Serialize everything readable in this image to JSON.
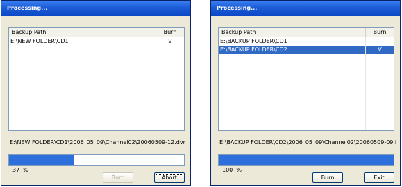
{
  "left_dialog": {
    "title": "Processing...",
    "column_path": "Backup Path",
    "column_burn": "Burn",
    "rows": [
      {
        "path": "E:\\NEW FOLDER\\CD1",
        "burn": "V"
      }
    ],
    "current_path": "E:\\NEW FOLDER\\CD1\\2006_05_09\\Channel02\\20060509-12.dvr",
    "progress_percent": 37,
    "percent_label": "37  %",
    "burn_label": "Burn",
    "abort_label": "Abort"
  },
  "right_dialog": {
    "title": "Processing...",
    "column_path": "Backup Path",
    "column_burn": "Burn",
    "rows": [
      {
        "path": "E:\\BACKUP FOLDER\\CD1",
        "burn": ""
      },
      {
        "path": "E:\\BACKUP FOLDER\\CD2",
        "burn": "V"
      }
    ],
    "current_path": "E:\\BACKUP FOLDER\\CD2\\2006_05_09\\Channel02\\20060509-09.i",
    "progress_percent": 100,
    "percent_label": "100  %",
    "burn_label": "Burn",
    "exit_label": "Exit"
  }
}
